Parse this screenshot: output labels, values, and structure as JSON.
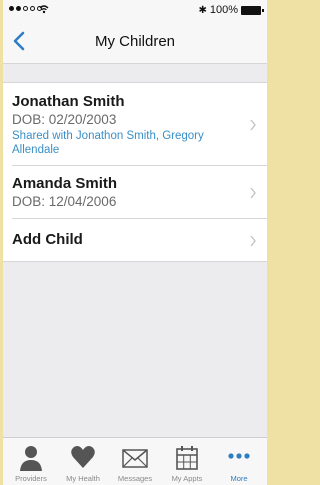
{
  "status_bar": {
    "battery": "100%"
  },
  "nav": {
    "title": "My Children",
    "back_icon": "chevron-left-icon"
  },
  "children": [
    {
      "name": "Jonathan Smith",
      "dob": "DOB: 02/20/2003",
      "shared": "Shared with Jonathon Smith, Gregory Allendale"
    },
    {
      "name": "Amanda Smith",
      "dob": "DOB: 12/04/2006"
    }
  ],
  "add_child_label": "Add Child",
  "tabs": [
    {
      "label": "Providers",
      "icon": "person-icon"
    },
    {
      "label": "My Health",
      "icon": "heart-icon"
    },
    {
      "label": "Messages",
      "icon": "envelope-icon"
    },
    {
      "label": "My Appts",
      "icon": "calendar-icon"
    },
    {
      "label": "More",
      "icon": "more-icon"
    }
  ],
  "colors": {
    "accent": "#2e7dc4",
    "shared_text": "#3a8fc6",
    "background": "#ececee",
    "frame": "#efe0a4"
  }
}
